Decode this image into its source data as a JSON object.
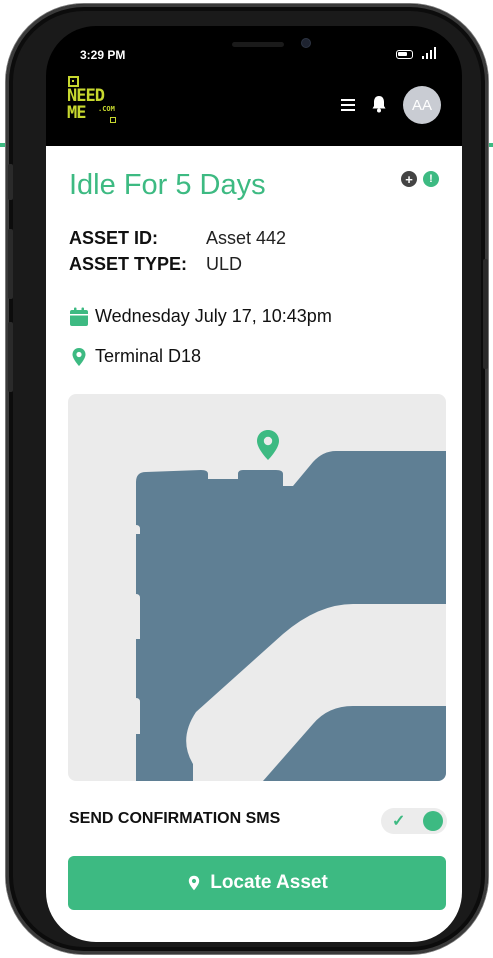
{
  "status_bar": {
    "time": "3:29 PM",
    "icons": [
      "battery-icon",
      "signal-icon"
    ]
  },
  "header": {
    "logo": {
      "line1": "NEED",
      "line2": "ME",
      "suffix": ".COM"
    },
    "icons": [
      "menu-icon",
      "bell-icon"
    ],
    "avatar_initials": "AA"
  },
  "card": {
    "title": "Idle For 5 Days",
    "corner_icons": [
      "plus-circle-icon",
      "info-circle-icon"
    ],
    "asset_id_label": "ASSET ID:",
    "asset_id_value": "Asset 442",
    "asset_type_label": "ASSET TYPE:",
    "asset_type_value": "ULD",
    "date_text": "Wednesday July 17, 10:43pm",
    "location_text": "Terminal D18"
  },
  "sms": {
    "label": "SEND CONFIRMATION SMS",
    "enabled": true
  },
  "locate_button": {
    "label": "Locate Asset"
  },
  "colors": {
    "accent": "#3dba82",
    "map_building": "#5f7f94",
    "map_background": "#ebebeb",
    "logo": "#c7d82f",
    "phone": "#1a1a1a"
  }
}
